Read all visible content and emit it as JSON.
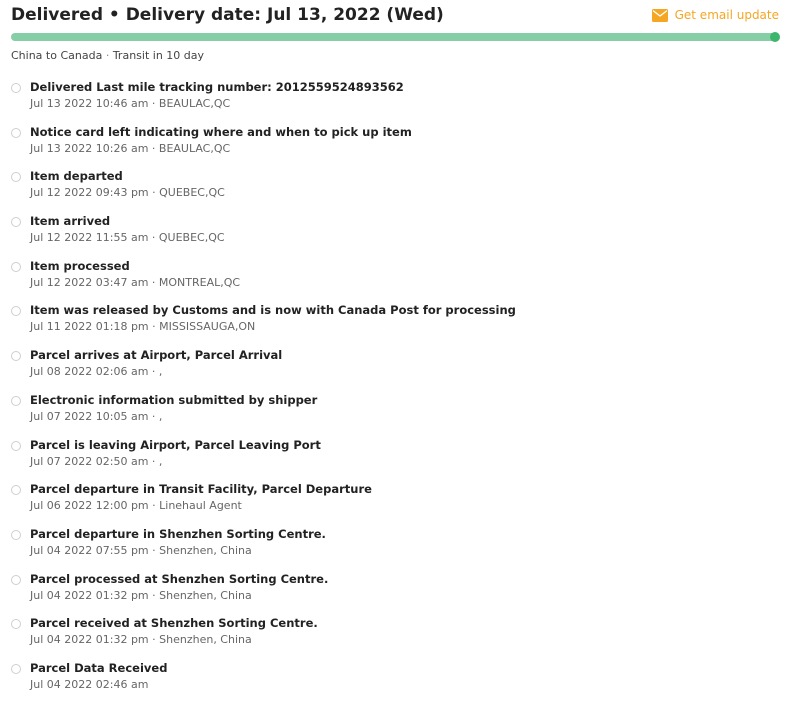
{
  "header": {
    "status": "Delivered • Delivery date: Jul 13, 2022 (Wed)",
    "email_update_label": "Get email update"
  },
  "progress": {
    "fraction": 1.0
  },
  "route": {
    "origin_dest": "China to Canada",
    "separator": "·",
    "transit": "Transit in 10 day"
  },
  "colors": {
    "accent": "#f5a623",
    "progress_fill": "#86cfa6",
    "progress_dot": "#3db56c"
  },
  "icons": {
    "email": "envelope-icon"
  },
  "events": [
    {
      "description": "Delivered Last mile tracking number: 2012559524893562",
      "meta": "Jul 13 2022 10:46 am · BEAULAC,QC"
    },
    {
      "description": "Notice card left indicating where and when to pick up item",
      "meta": "Jul 13 2022 10:26 am · BEAULAC,QC"
    },
    {
      "description": "Item departed",
      "meta": "Jul 12 2022 09:43 pm · QUEBEC,QC"
    },
    {
      "description": "Item arrived",
      "meta": "Jul 12 2022 11:55 am · QUEBEC,QC"
    },
    {
      "description": "Item processed",
      "meta": "Jul 12 2022 03:47 am · MONTREAL,QC"
    },
    {
      "description": "Item was released by Customs and is now with Canada Post for processing",
      "meta": "Jul 11 2022 01:18 pm · MISSISSAUGA,ON"
    },
    {
      "description": "Parcel arrives at Airport, Parcel Arrival",
      "meta": "Jul 08 2022 02:06 am · ,"
    },
    {
      "description": "Electronic information submitted by shipper",
      "meta": "Jul 07 2022 10:05 am · ,"
    },
    {
      "description": "Parcel is leaving Airport, Parcel Leaving Port",
      "meta": "Jul 07 2022 02:50 am · ,"
    },
    {
      "description": "Parcel departure in Transit Facility, Parcel Departure",
      "meta": "Jul 06 2022 12:00 pm · Linehaul Agent"
    },
    {
      "description": "Parcel departure in Shenzhen Sorting Centre.",
      "meta": "Jul 04 2022 07:55 pm · Shenzhen, China"
    },
    {
      "description": "Parcel processed at Shenzhen Sorting Centre.",
      "meta": "Jul 04 2022 01:32 pm · Shenzhen, China"
    },
    {
      "description": "Parcel received at Shenzhen Sorting Centre.",
      "meta": "Jul 04 2022 01:32 pm · Shenzhen, China"
    },
    {
      "description": "Parcel Data Received",
      "meta": "Jul 04 2022 02:46 am"
    }
  ]
}
